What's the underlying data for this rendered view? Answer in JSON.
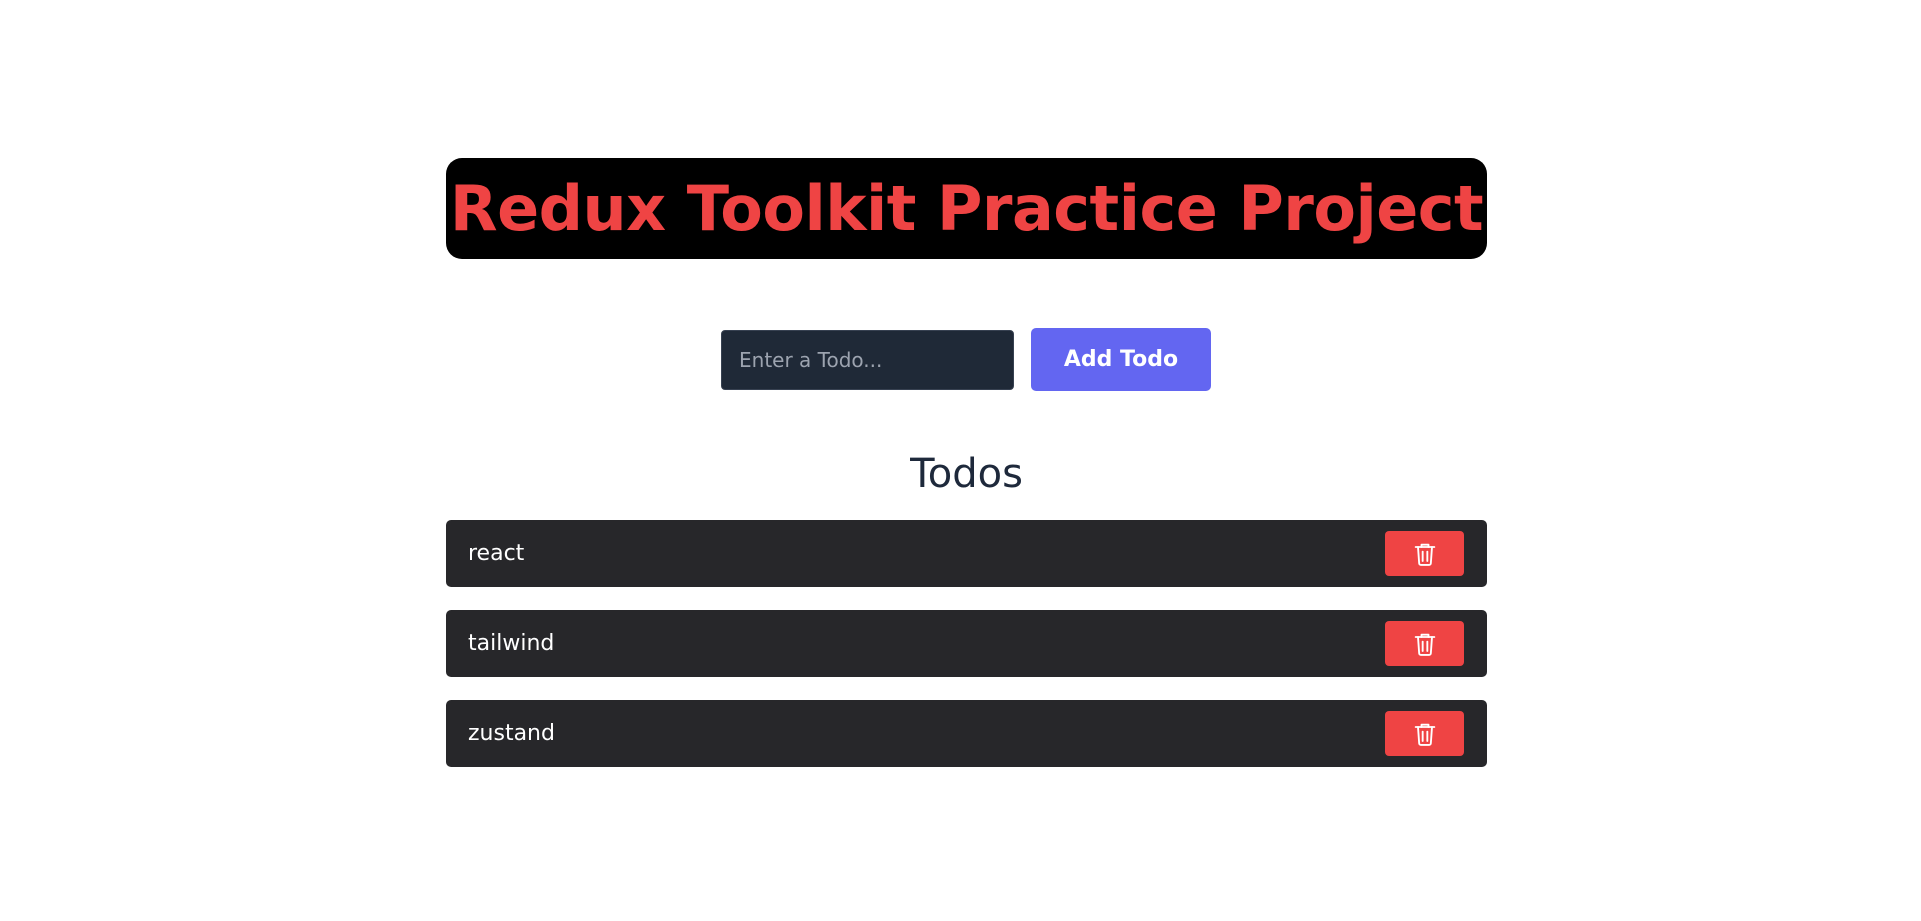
{
  "header": {
    "title": "Redux Toolkit Practice Project"
  },
  "form": {
    "input_value": "",
    "input_placeholder": "Enter a Todo...",
    "add_label": "Add Todo"
  },
  "todos": {
    "heading": "Todos",
    "items": [
      {
        "text": "react",
        "delete_icon": "trash-icon"
      },
      {
        "text": "tailwind",
        "delete_icon": "trash-icon"
      },
      {
        "text": "zustand",
        "delete_icon": "trash-icon"
      }
    ]
  },
  "colors": {
    "title_text": "#ef4444",
    "title_bg": "#000000",
    "input_bg": "#1f2937",
    "add_button": "#6366f1",
    "heading": "#1e293b",
    "todo_bg": "#27272a",
    "delete_button": "#ef4444"
  }
}
